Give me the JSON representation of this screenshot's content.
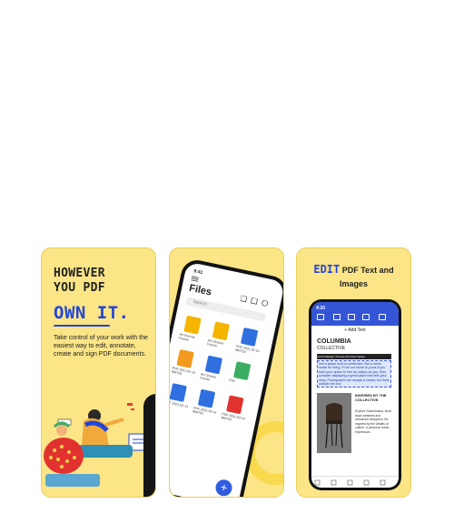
{
  "card1": {
    "headline_line1": "HOWEVER",
    "headline_line2": "YOU PDF",
    "headline_accent": "OWN IT.",
    "description": "Take control of your work with the easiest way to edit, annotate, create and sign PDF documents."
  },
  "card2": {
    "time": "9:41",
    "title": "Files",
    "search_placeholder": "Search",
    "files": [
      {
        "label": "Art Director Course",
        "type": "folder"
      },
      {
        "label": "Art Director Course",
        "type": "folder"
      },
      {
        "label": "PDF 2021-02-14 884753",
        "type": "doc-blue"
      },
      {
        "label": "PDF 2021-02-14 884753",
        "type": "doc-orange"
      },
      {
        "label": "Art Director Course",
        "type": "doc-blue"
      },
      {
        "label": "PDF",
        "type": "doc-green"
      },
      {
        "label": "PDF 2021-02-14",
        "type": "doc-blue"
      },
      {
        "label": "PDF 2021-02-14 884753",
        "type": "doc-blue"
      },
      {
        "label": "PDF 2021-02-14 884753",
        "type": "doc-red"
      }
    ],
    "fab_label": "+"
  },
  "card3": {
    "headline_accent": "EDIT",
    "headline_rest": "PDF Text and",
    "headline_line2": "Images",
    "time": "4:20",
    "add_text": "+ Add Text",
    "doc_title": "COLUMBIA",
    "doc_subtitle": "COLLECTIVE",
    "menu": "Cut   Fit Backgr.   Choose Fill   Color   Delete",
    "selected_text": "Not a space built on perfection. But a home made for living. From our home to yours if you want your space to feel as unique as you, then consider displaying a great place that tells your story. Photographs are always a classic but think outside the box.",
    "inspired": "INSPIRED BY THE COLLECTIVE.",
    "body": "Explore Scandinavia, short local creatives and renowned designers. Be inspired by the details of culture. A personal home expression."
  },
  "colors": {
    "card_bg": "#fbe587",
    "accent_blue": "#2346d8",
    "toolbar_blue": "#3355d6",
    "fab_blue": "#2f5ce0"
  }
}
